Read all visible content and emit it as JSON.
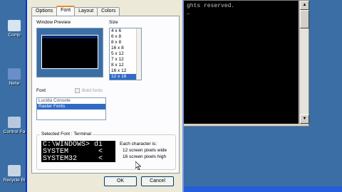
{
  "desktop": {
    "icons": [
      {
        "label": "Comp",
        "icon": "my-computer-icon",
        "color": "#d8e4f0"
      },
      {
        "label": "Netw",
        "icon": "network-icon",
        "color": "#6a8fc8"
      },
      {
        "label": "Control Pa",
        "icon": "control-panel-icon",
        "color": "#b8c8e0"
      },
      {
        "label": "Recycle Bi",
        "icon": "recycle-bin-icon",
        "color": "#c8d4e4"
      }
    ]
  },
  "console": {
    "line1": "ghts reserved.",
    "cursor": "_"
  },
  "dialog": {
    "tabs": [
      "Options",
      "Font",
      "Layout",
      "Colors"
    ],
    "active_tab": "Font",
    "window_preview_label": "Window Preview",
    "size_label": "Size",
    "sizes": [
      "4 x  6",
      "6 x  8",
      "8 x  8",
      "16 x  8",
      "5 x 12",
      "7 x 12",
      "8 x 12",
      "16 x 12",
      "12 x 16"
    ],
    "selected_size": "12 x 16",
    "font_label": "Font",
    "bold_label": "Bold fonts",
    "fonts": [
      "Lucida Console",
      "Raster Fonts"
    ],
    "selected_font": "Raster Fonts",
    "selected_font_legend": "Selected Font : Terminal",
    "sample_lines": [
      "C:\\WINDOWS> di",
      "SYSTEM       <",
      "SYSTEM32     <"
    ],
    "char_info_title": "Each character is:",
    "char_width": "12 screen pixels wide",
    "char_height": "16 screen pixels high",
    "ok_label": "OK",
    "cancel_label": "Cancel"
  }
}
